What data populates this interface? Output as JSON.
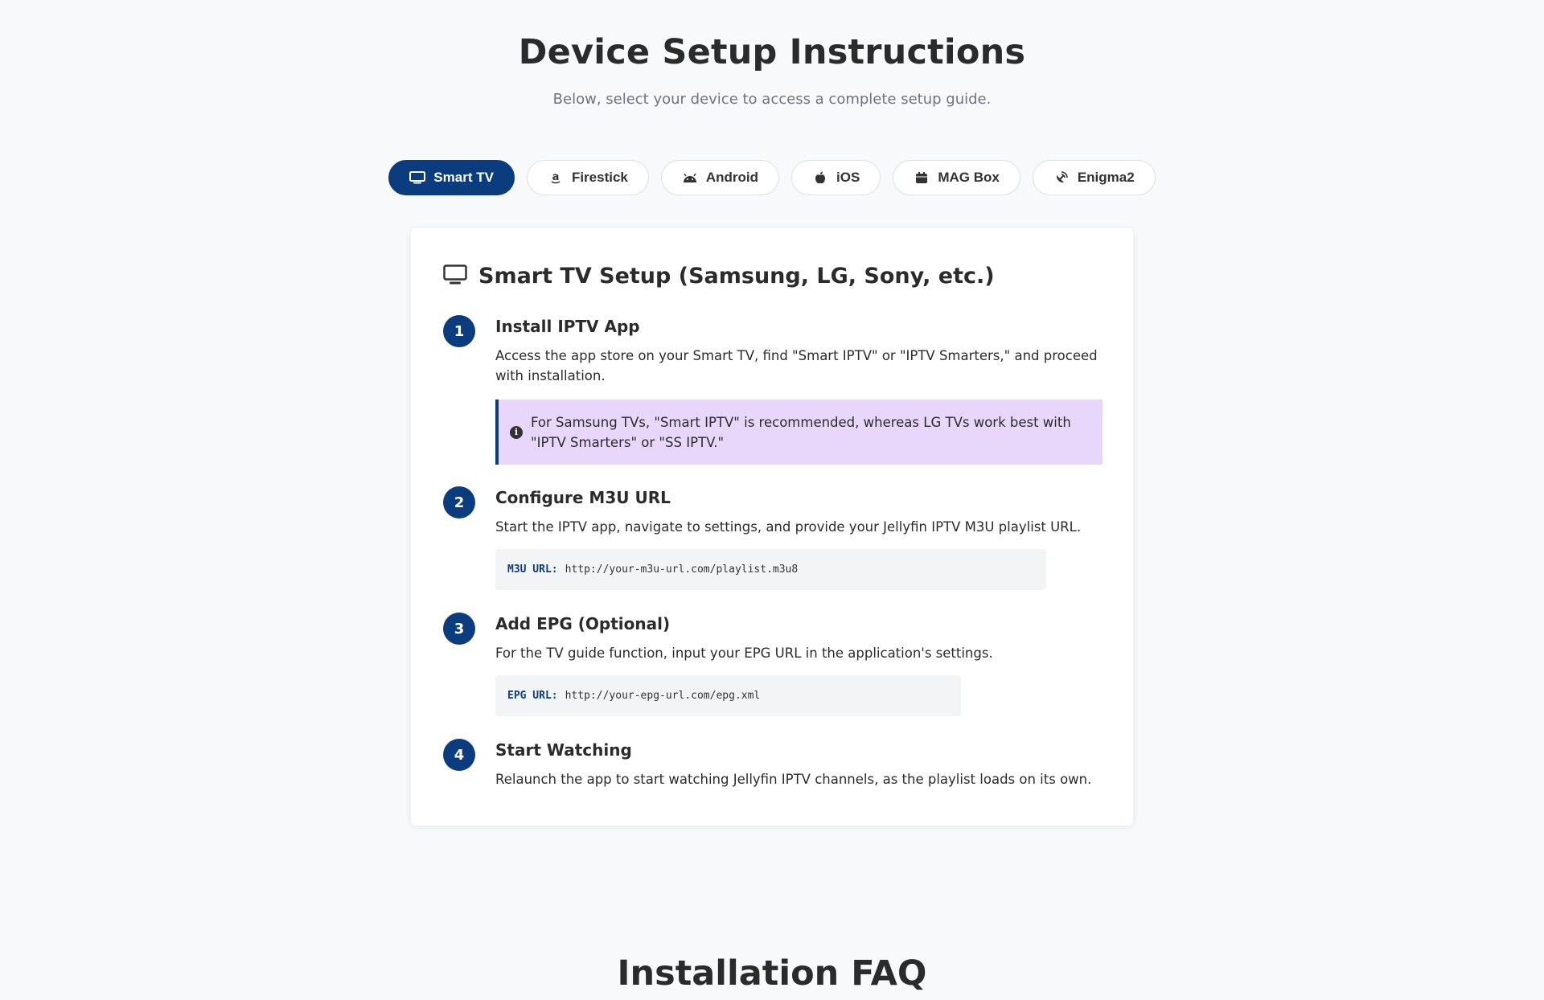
{
  "page": {
    "title": "Device Setup Instructions",
    "subtitle": "Below, select your device to access a complete setup guide."
  },
  "tabs": [
    {
      "label": "Smart TV",
      "icon": "tv-icon",
      "active": true
    },
    {
      "label": "Firestick",
      "icon": "amazon-icon",
      "active": false
    },
    {
      "label": "Android",
      "icon": "android-icon",
      "active": false
    },
    {
      "label": "iOS",
      "icon": "apple-icon",
      "active": false
    },
    {
      "label": "MAG Box",
      "icon": "box-icon",
      "active": false
    },
    {
      "label": "Enigma2",
      "icon": "satellite-dish-icon",
      "active": false
    }
  ],
  "card": {
    "title": "Smart TV Setup (Samsung, LG, Sony, etc.)",
    "icon": "tv-icon",
    "steps": [
      {
        "number": "1",
        "title": "Install IPTV App",
        "text": "Access the app store on your Smart TV, find \"Smart IPTV\" or \"IPTV Smarters,\" and proceed with installation.",
        "note": "For Samsung TVs, \"Smart IPTV\" is recommended, whereas LG TVs work best with \"IPTV Smarters\" or \"SS IPTV.\""
      },
      {
        "number": "2",
        "title": "Configure M3U URL",
        "text": "Start the IPTV app, navigate to settings, and provide your Jellyfin IPTV M3U playlist URL.",
        "code_label": "M3U URL:",
        "code_value": "http://your-m3u-url.com/playlist.m3u8"
      },
      {
        "number": "3",
        "title": "Add EPG (Optional)",
        "text": "For the TV guide function, input your EPG URL in the application's settings.",
        "code_label": "EPG URL:",
        "code_value": "http://your-epg-url.com/epg.xml"
      },
      {
        "number": "4",
        "title": "Start Watching",
        "text": "Relaunch the app to start watching Jellyfin IPTV channels, as the playlist loads on its own."
      }
    ]
  },
  "faq": {
    "title": "Installation FAQ"
  },
  "colors": {
    "accent": "#0b3d7e",
    "note_bg": "#e8d6fb",
    "page_bg": "#f8f9fa"
  }
}
